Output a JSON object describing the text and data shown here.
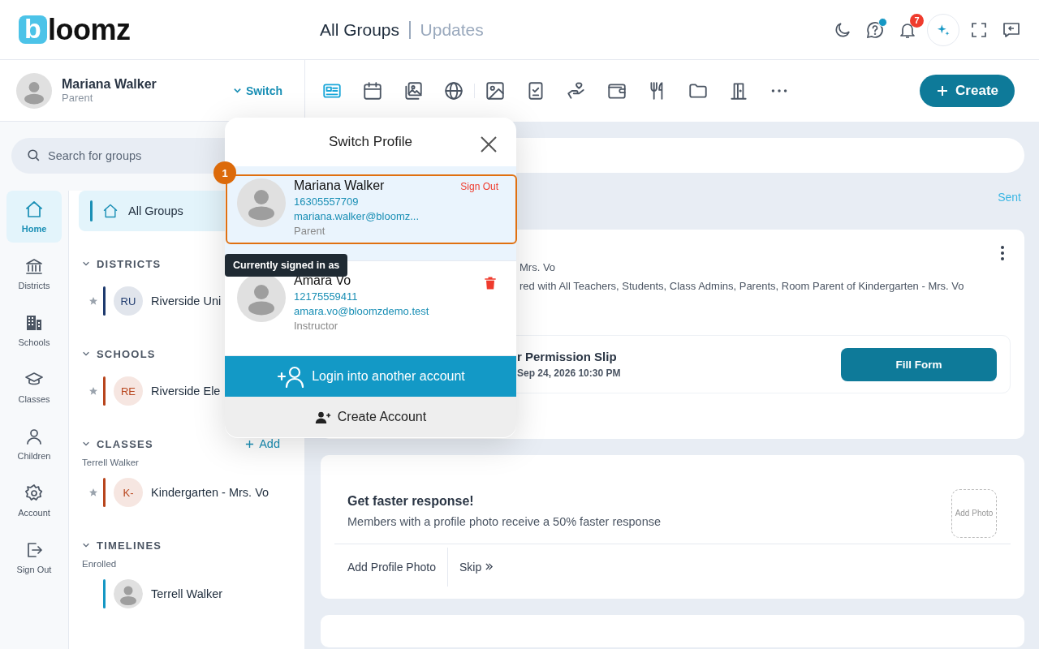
{
  "header": {
    "logo_mark": "b",
    "logo_text": "loomz",
    "title": "All Groups",
    "subtitle": "Updates",
    "notifications": "7"
  },
  "profile": {
    "name": "Mariana Walker",
    "role": "Parent",
    "switch_label": "Switch"
  },
  "search": {
    "placeholder": "Search for groups"
  },
  "nav": [
    {
      "label": "Home",
      "selected": true
    },
    {
      "label": "Districts",
      "selected": false
    },
    {
      "label": "Schools",
      "selected": false
    },
    {
      "label": "Classes",
      "selected": false
    },
    {
      "label": "Children",
      "selected": false
    },
    {
      "label": "Account",
      "selected": false
    },
    {
      "label": "Sign Out",
      "selected": false
    }
  ],
  "all_groups": {
    "label": "All Groups",
    "selected": true
  },
  "sections": [
    {
      "title": "DISTRICTS",
      "items": [
        {
          "kind": "initials",
          "initials": "RU",
          "name": "Riverside Uni",
          "color": "#1e3a6e"
        }
      ]
    },
    {
      "title": "SCHOOLS",
      "items": [
        {
          "kind": "initials",
          "initials": "RE",
          "name": "Riverside Ele",
          "color": "#b8451d"
        }
      ]
    },
    {
      "title": "CLASSES",
      "action": "Add",
      "subtitle": "Terrell Walker",
      "items": [
        {
          "kind": "initials",
          "initials": "K-",
          "name": "Kindergarten - Mrs. Vo",
          "color": "#b8451d"
        }
      ]
    },
    {
      "title": "TIMELINES",
      "subtitle": "Enrolled",
      "items": [
        {
          "kind": "avatar",
          "name": "Terrell Walker",
          "color": "#1597c4"
        }
      ]
    }
  ],
  "toolbar": [
    {
      "selected": true
    },
    {
      "selected": false
    },
    {
      "selected": false
    },
    {
      "selected": false
    },
    {
      "selected": false
    },
    {
      "selected": false
    },
    {
      "selected": false
    },
    {
      "selected": false
    },
    {
      "selected": false
    },
    {
      "selected": false
    },
    {
      "selected": false
    },
    {
      "selected": false
    }
  ],
  "create_label": "Create",
  "feed": {
    "sent_label": "Sent",
    "post": {
      "line1": "Mrs. Vo",
      "line2": "red with All Teachers, Students, Class Admins, Parents, Room Parent of Kindergarten - Mrs. Vo",
      "form_title": "r Permission Slip",
      "form_due": "Sep 24, 2026 10:30 PM",
      "form_button": "Fill Form"
    },
    "prompt": {
      "title": "Get faster response!",
      "text": "Members with a profile photo receive a 50% faster response",
      "photo_label": "Add Photo",
      "add_label": "Add Profile Photo",
      "skip_label": "Skip"
    }
  },
  "switch_profile": {
    "title": "Switch Profile",
    "step": "1",
    "tooltip": "Currently signed in as",
    "accounts": [
      {
        "name": "Mariana Walker",
        "phone": "16305557709",
        "email": "mariana.walker@bloomz...",
        "role": "Parent",
        "selected": true,
        "kind": "sign_out",
        "action_label": "Sign Out"
      },
      {
        "name": "Amara Vo",
        "phone": "12175559411",
        "email": "amara.vo@bloomzdemo.test",
        "role": "Instructor",
        "selected": false,
        "kind": "delete"
      }
    ],
    "login_label": "Login into another account",
    "create_label": "Create Account"
  }
}
